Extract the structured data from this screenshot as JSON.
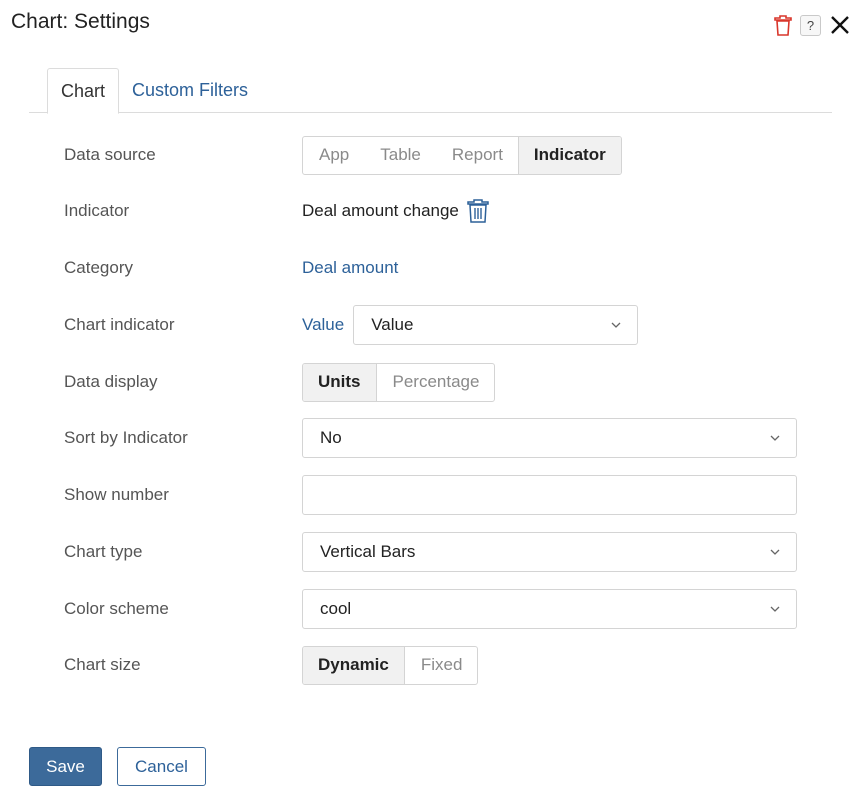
{
  "dialog": {
    "title": "Chart: Settings",
    "help_label": "?"
  },
  "tabs": [
    {
      "label": "Chart",
      "active": true
    },
    {
      "label": "Custom Filters",
      "active": false
    }
  ],
  "fields": {
    "data_source": {
      "label": "Data source",
      "options": [
        "App",
        "Table",
        "Report",
        "Indicator"
      ],
      "selected": "Indicator"
    },
    "indicator": {
      "label": "Indicator",
      "value": "Deal amount change"
    },
    "category": {
      "label": "Category",
      "value": "Deal amount"
    },
    "chart_indicator": {
      "label": "Chart indicator",
      "link": "Value",
      "value": "Value"
    },
    "data_display": {
      "label": "Data display",
      "options": [
        "Units",
        "Percentage"
      ],
      "selected": "Units"
    },
    "sort_by_indicator": {
      "label": "Sort by Indicator",
      "value": "No"
    },
    "show_number": {
      "label": "Show number",
      "value": ""
    },
    "chart_type": {
      "label": "Chart type",
      "value": "Vertical Bars"
    },
    "color_scheme": {
      "label": "Color scheme",
      "value": "cool"
    },
    "chart_size": {
      "label": "Chart size",
      "options": [
        "Dynamic",
        "Fixed"
      ],
      "selected": "Dynamic"
    }
  },
  "actions": {
    "save_label": "Save",
    "cancel_label": "Cancel"
  },
  "colors": {
    "accent": "#2d6199",
    "primary_button": "#3c6a9a",
    "delete_icon": "#d9362b"
  }
}
